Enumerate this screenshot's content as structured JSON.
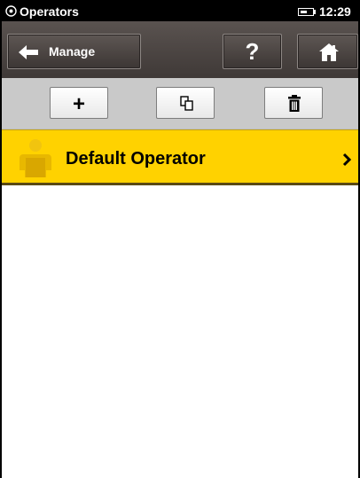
{
  "status_bar": {
    "title": "Operators",
    "time": "12:29",
    "battery_level": 0.6
  },
  "toolbar": {
    "back_label": "Manage",
    "help_label": "?"
  },
  "actions": {
    "add_label": "+"
  },
  "operators": [
    {
      "name": "Default Operator"
    }
  ],
  "colors": {
    "selected_item": "#ffd200",
    "toolbar": "#4a4442",
    "action_bar": "#c9c9c9"
  },
  "icons": {
    "back": "arrow-left-icon",
    "home": "home-icon",
    "copy": "copy-icon",
    "delete": "trash-icon",
    "operator": "person-icon",
    "open": "chevron-right-icon"
  }
}
